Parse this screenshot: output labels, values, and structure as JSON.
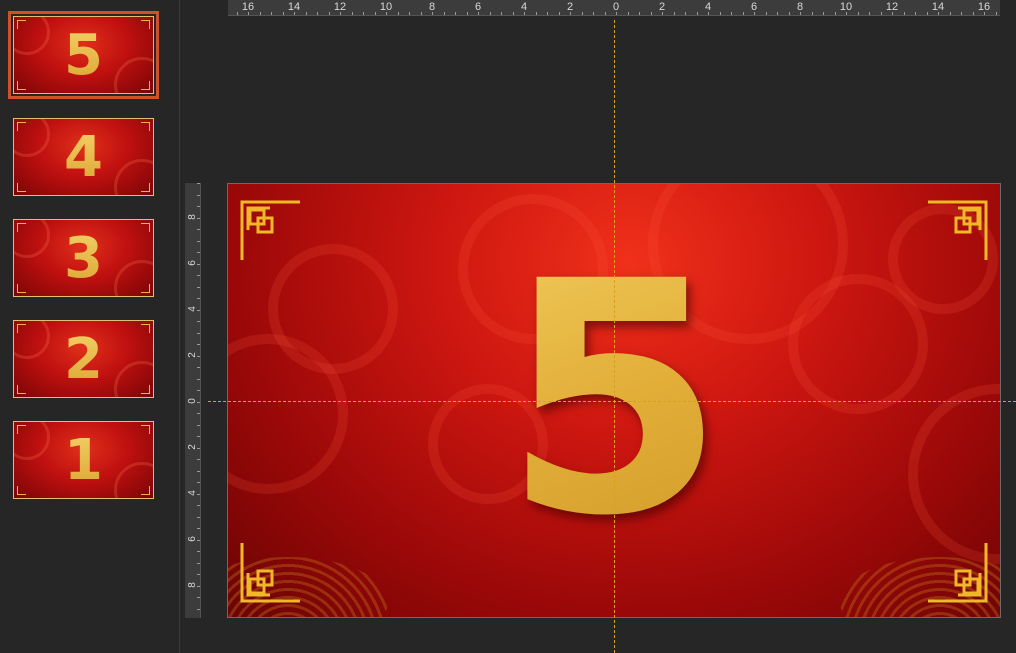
{
  "thumbnails": [
    {
      "label": "5",
      "selected": true
    },
    {
      "label": "4",
      "selected": false
    },
    {
      "label": "3",
      "selected": false
    },
    {
      "label": "2",
      "selected": false
    },
    {
      "label": "1",
      "selected": false
    }
  ],
  "ruler": {
    "horizontal_labels": [
      "16",
      "14",
      "12",
      "10",
      "8",
      "6",
      "4",
      "2",
      "0",
      "2",
      "4",
      "6",
      "8",
      "10",
      "12",
      "14",
      "16"
    ],
    "vertical_labels": [
      "8",
      "6",
      "4",
      "2",
      "0",
      "2",
      "4",
      "6",
      "8"
    ]
  },
  "slide": {
    "number": "5"
  },
  "colors": {
    "gold": "#e8b840",
    "red": "#cc1610",
    "guide": "#d8a020",
    "selection": "#d0502a"
  }
}
